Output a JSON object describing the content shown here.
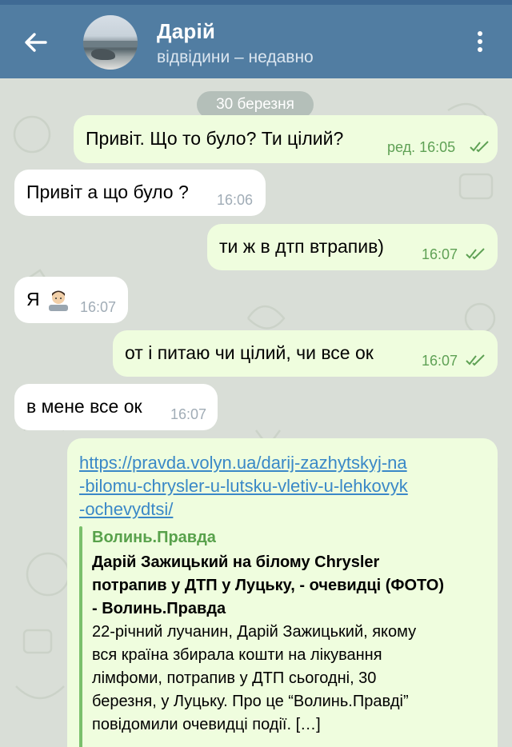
{
  "header": {
    "back_icon": "arrow-left-icon",
    "contact_name": "Дарій",
    "contact_status": "відвідини – недавно",
    "menu_icon": "more-vertical-icon",
    "bar_color": "#517da2"
  },
  "chat": {
    "date_label": "30 березня",
    "messages": [
      {
        "direction": "out",
        "text": "Привіт. Що то було? Ти цілий?",
        "meta": "ред. 16:05",
        "status": "read"
      },
      {
        "direction": "in",
        "text": "Привіт а що було ?",
        "meta": "16:06"
      },
      {
        "direction": "out",
        "text": "ти ж в дтп втрапив)",
        "meta": "16:07",
        "status": "read"
      },
      {
        "direction": "in",
        "text": "Я",
        "emoji": "man-technologist-emoji",
        "meta": "16:07"
      },
      {
        "direction": "out",
        "text": "от і питаю чи цілий, чи все ок",
        "meta": "16:07",
        "status": "read"
      },
      {
        "direction": "in",
        "text": "в мене все ок",
        "meta": "16:07"
      }
    ],
    "link_message": {
      "direction": "out",
      "url_lines": [
        "https://pravda.volyn.ua/darij-zazhytskyj-na",
        "-bilomu-chrysler-u-lutsku-vletiv-u-lehkovyk",
        "-ochevydtsi/"
      ],
      "preview": {
        "site_name": "Волинь.Правда",
        "title_lines": [
          "Дарій Зажицький на білому Chrysler",
          "потрапив у ДТП у Луцьку, - очевидці (ФОТО)",
          "- Волинь.Правда"
        ],
        "description_lines": [
          "22-річний лучанин, Дарій Зажицький, якому",
          "вся країна збирала кошти на лікування",
          "лімфоми, потрапив у ДТП сьогодні, 30",
          "березня, у Луцьку. Про це “Волинь.Правді”",
          "повідомили очевидці події. […]"
        ]
      }
    },
    "colors": {
      "outgoing_bubble": "#effdde",
      "incoming_bubble": "#ffffff",
      "outgoing_meta": "#5fa155",
      "link": "#3a88c7"
    }
  }
}
